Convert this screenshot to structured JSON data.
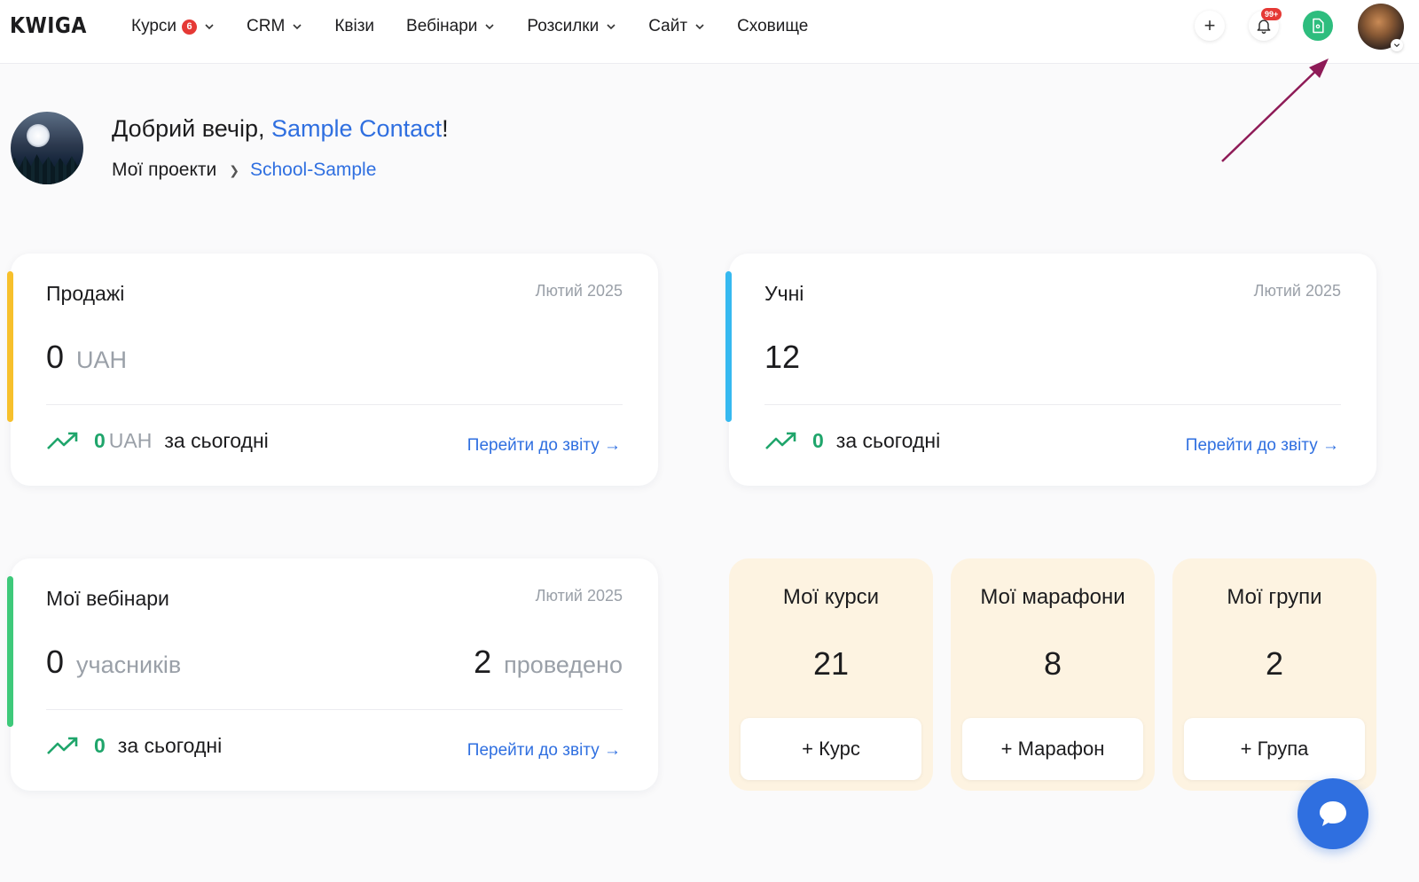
{
  "brand": "KWIGA",
  "nav": [
    {
      "label": "Курси",
      "badge": "6",
      "dropdown": true
    },
    {
      "label": "CRM",
      "dropdown": true
    },
    {
      "label": "Квізи",
      "dropdown": false
    },
    {
      "label": "Вебінари",
      "dropdown": true
    },
    {
      "label": "Розсилки",
      "dropdown": true
    },
    {
      "label": "Сайт",
      "dropdown": true
    },
    {
      "label": "Сховище",
      "dropdown": false
    }
  ],
  "topbar": {
    "plus_icon": "+",
    "notifications_badge": "99+"
  },
  "greeting": {
    "prefix": "Добрий вечір, ",
    "name": "Sample Contact",
    "suffix": "!"
  },
  "breadcrumb": {
    "root": "Мої проекти",
    "current": "School-Sample"
  },
  "sales": {
    "title": "Продажі",
    "date": "Лютий 2025",
    "value": "0",
    "unit": "UAH",
    "today_value": "0",
    "today_unit": "UAH",
    "today_text": "за сьогодні",
    "link": "Перейти до звіту →",
    "accent": "#f7c02c"
  },
  "students": {
    "title": "Учні",
    "date": "Лютий 2025",
    "value": "12",
    "today_value": "0",
    "today_text": "за сьогодні",
    "link": "Перейти до звіту →",
    "accent": "#36b9f0"
  },
  "webinars": {
    "title": "Мої вебінари",
    "date": "Лютий 2025",
    "participants_value": "0",
    "participants_label": "учасників",
    "held_value": "2",
    "held_label": "проведено",
    "today_value": "0",
    "today_text": "за сьогодні",
    "link": "Перейти до звіту →",
    "accent": "#3ec97a"
  },
  "tiles": [
    {
      "title": "Мої курси",
      "value": "21",
      "button": "+ Курс"
    },
    {
      "title": "Мої марафони",
      "value": "8",
      "button": "+ Марафон"
    },
    {
      "title": "Мої групи",
      "value": "2",
      "button": "+ Група"
    }
  ],
  "colors": {
    "link": "#2f6fe0",
    "positive": "#1fa56b",
    "tile_bg": "#fdf3e1",
    "annotation_arrow": "#8e1b57"
  }
}
